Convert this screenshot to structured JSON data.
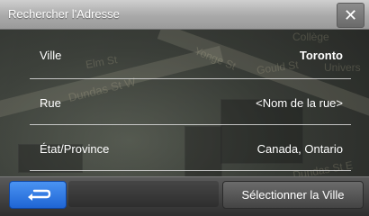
{
  "dialog": {
    "title": "Rechercher l'Adresse",
    "close_icon": "close-icon"
  },
  "map": {
    "labels": [
      "Elm St",
      "Yonge St",
      "Dundas St W",
      "Gould St",
      "Univers",
      "Collège",
      "Dundas St E"
    ]
  },
  "rows": [
    {
      "label": "Ville",
      "value": "Toronto",
      "value_bold": true
    },
    {
      "label": "Rue",
      "value": "<Nom de la rue>",
      "value_bold": false
    },
    {
      "label": "État/Province",
      "value": "Canada, Ontario",
      "value_bold": false
    }
  ],
  "bottom": {
    "back_icon": "back-arrow-icon",
    "action_label": "Sélectionner la Ville"
  },
  "colors": {
    "back_button": "#2f7ae5",
    "title_bar": "#a9a9a9"
  }
}
